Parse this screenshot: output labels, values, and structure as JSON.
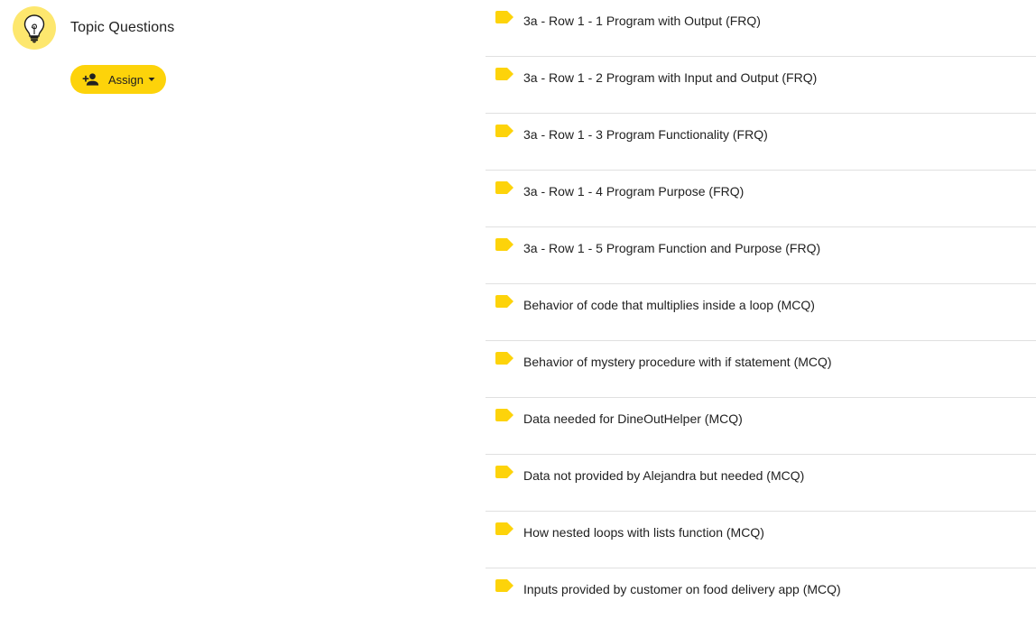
{
  "header": {
    "title": "Topic Questions",
    "icon": "lightbulb-icon",
    "icon_bg_color": "#fde76e"
  },
  "assign_button": {
    "label": "Assign",
    "icon": "person-add-icon",
    "color": "#fdd30a"
  },
  "questions": [
    {
      "label": "3a - Row 1 - 1 Program with Output (FRQ)",
      "icon": "tag-icon"
    },
    {
      "label": "3a - Row 1 - 2 Program with Input and Output (FRQ)",
      "icon": "tag-icon"
    },
    {
      "label": "3a - Row 1 - 3 Program Functionality (FRQ)",
      "icon": "tag-icon"
    },
    {
      "label": "3a - Row 1 - 4 Program Purpose (FRQ)",
      "icon": "tag-icon"
    },
    {
      "label": "3a - Row 1 - 5 Program Function and Purpose (FRQ)",
      "icon": "tag-icon"
    },
    {
      "label": "Behavior of code that multiplies inside a loop (MCQ)",
      "icon": "tag-icon"
    },
    {
      "label": "Behavior of mystery procedure with if statement (MCQ)",
      "icon": "tag-icon"
    },
    {
      "label": "Data needed for DineOutHelper (MCQ)",
      "icon": "tag-icon"
    },
    {
      "label": "Data not provided by Alejandra but needed (MCQ)",
      "icon": "tag-icon"
    },
    {
      "label": "How nested loops with lists function (MCQ)",
      "icon": "tag-icon"
    },
    {
      "label": "Inputs provided by customer on food delivery app (MCQ)",
      "icon": "tag-icon"
    }
  ],
  "colors": {
    "accent": "#fdd30a",
    "tag": "#fdd30a",
    "divider": "#e0e0e0"
  }
}
